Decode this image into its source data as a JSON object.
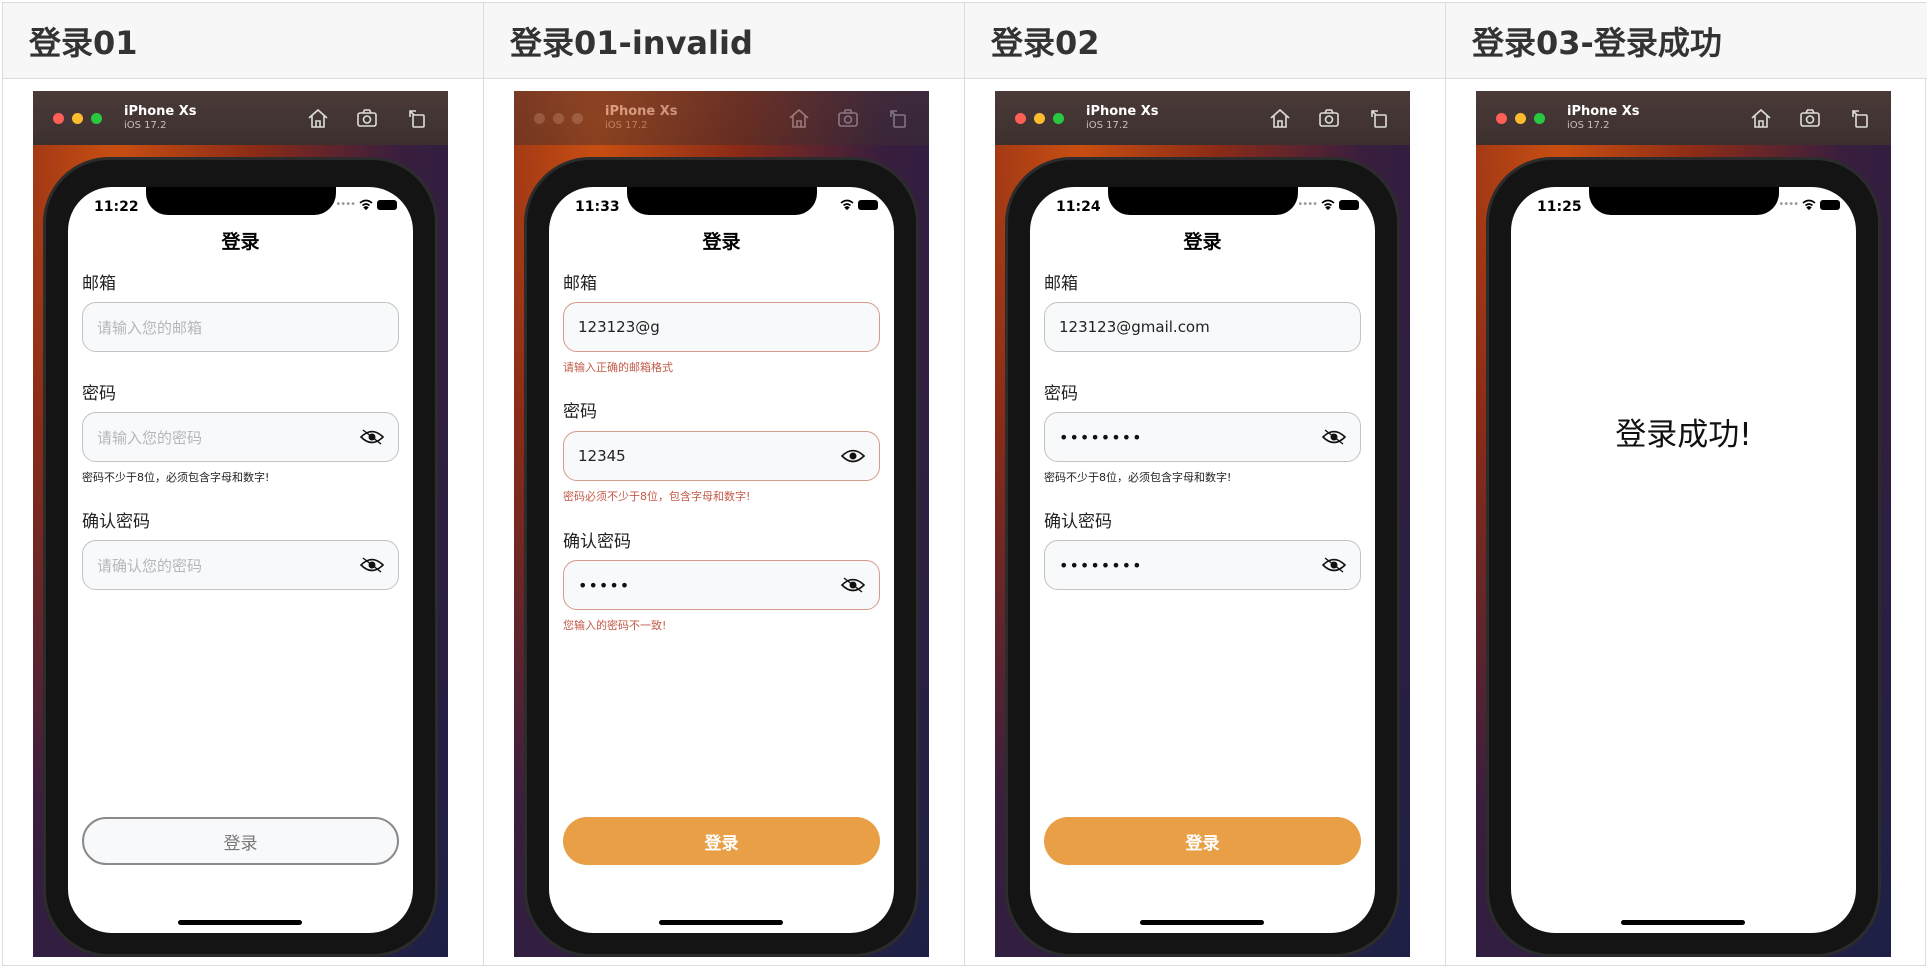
{
  "columns": [
    {
      "title": "登录01",
      "sim": {
        "device": "iPhone Xs",
        "os": "iOS 17.2"
      },
      "phone": {
        "time": "11:22",
        "page_title": "登录",
        "email_label": "邮箱",
        "email_placeholder": "请输入您的邮箱",
        "password_label": "密码",
        "password_placeholder": "请输入您的密码",
        "password_hint": "密码不少于8位，必须包含字母和数字!",
        "confirm_label": "确认密码",
        "confirm_placeholder": "请确认您的密码",
        "login_button": "登录"
      }
    },
    {
      "title": "登录01-invalid",
      "sim": {
        "device": "iPhone Xs",
        "os": "iOS 17.2"
      },
      "phone": {
        "time": "11:33",
        "page_title": "登录",
        "email_label": "邮箱",
        "email_value": "123123@g",
        "email_error": "请输入正确的邮箱格式",
        "password_label": "密码",
        "password_value": "12345",
        "password_error": "密码必须不少于8位，包含字母和数字!",
        "confirm_label": "确认密码",
        "confirm_value": "•••••",
        "confirm_error": "您输入的密码不一致!",
        "login_button": "登录"
      }
    },
    {
      "title": "登录02",
      "sim": {
        "device": "iPhone Xs",
        "os": "iOS 17.2"
      },
      "phone": {
        "time": "11:24",
        "page_title": "登录",
        "email_label": "邮箱",
        "email_value": "123123@gmail.com",
        "password_label": "密码",
        "password_value": "••••••••",
        "password_hint": "密码不少于8位，必须包含字母和数字!",
        "confirm_label": "确认密码",
        "confirm_value": "••••••••",
        "login_button": "登录"
      }
    },
    {
      "title": "登录03-登录成功",
      "sim": {
        "device": "iPhone Xs",
        "os": "iOS 17.2"
      },
      "phone": {
        "time": "11:25",
        "success_text": "登录成功!"
      }
    }
  ],
  "colors": {
    "accent": "#e89f46",
    "error": "#c25a4a",
    "traffic_red": "#ff5f57",
    "traffic_yellow": "#febc2e",
    "traffic_green": "#28c840"
  },
  "icons": {
    "sim_toolbar": [
      "home-icon",
      "screenshot-icon",
      "rotate-icon"
    ],
    "password_toggle": "eye-icon"
  }
}
